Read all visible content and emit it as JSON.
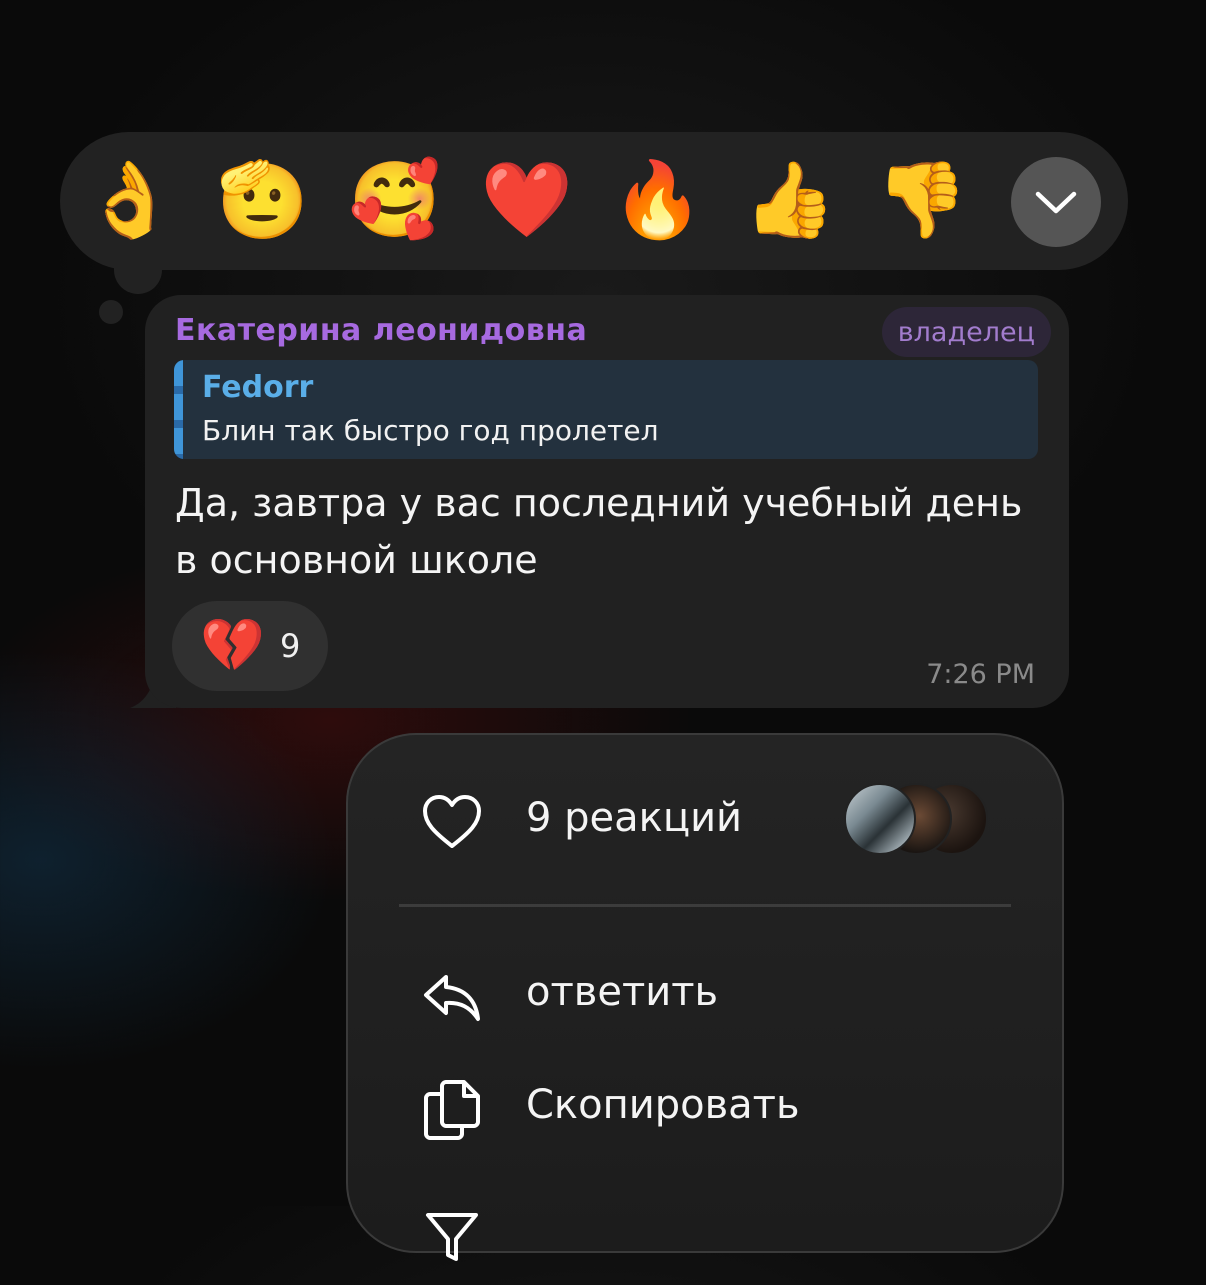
{
  "reaction_bar": {
    "emojis": [
      {
        "name": "ok-hand",
        "char": "👌"
      },
      {
        "name": "saluting-face",
        "char": "🫡"
      },
      {
        "name": "smiling-face-with-hearts",
        "char": "🥰"
      },
      {
        "name": "red-heart",
        "char": "❤️"
      },
      {
        "name": "fire",
        "char": "🔥"
      },
      {
        "name": "thumbs-up",
        "char": "👍"
      },
      {
        "name": "thumbs-down",
        "char": "👎"
      }
    ],
    "expand_icon": "chevron-down-icon"
  },
  "message": {
    "sender": "Екатерина леонидовна",
    "badge": "владелец",
    "reply": {
      "author": "Fedorr",
      "text": "Блин так быстро год пролетел"
    },
    "text": "Да, завтра у вас последний учебный день в основной школе",
    "reaction": {
      "emoji": "💔",
      "count": "9"
    },
    "time": "7:26 PM"
  },
  "context_menu": {
    "reactions_summary": "9 реакций",
    "reactions_icon": "heart-outline-icon",
    "items": [
      {
        "label": "ответить",
        "icon": "reply-icon"
      },
      {
        "label": "Скопировать",
        "icon": "copy-icon"
      }
    ]
  },
  "colors": {
    "sender_name": "#a76ae0",
    "badge_text": "#a27ccd",
    "reply_author": "#5aaee8",
    "bubble_bg": "#212121",
    "time": "#8a8a8a"
  }
}
